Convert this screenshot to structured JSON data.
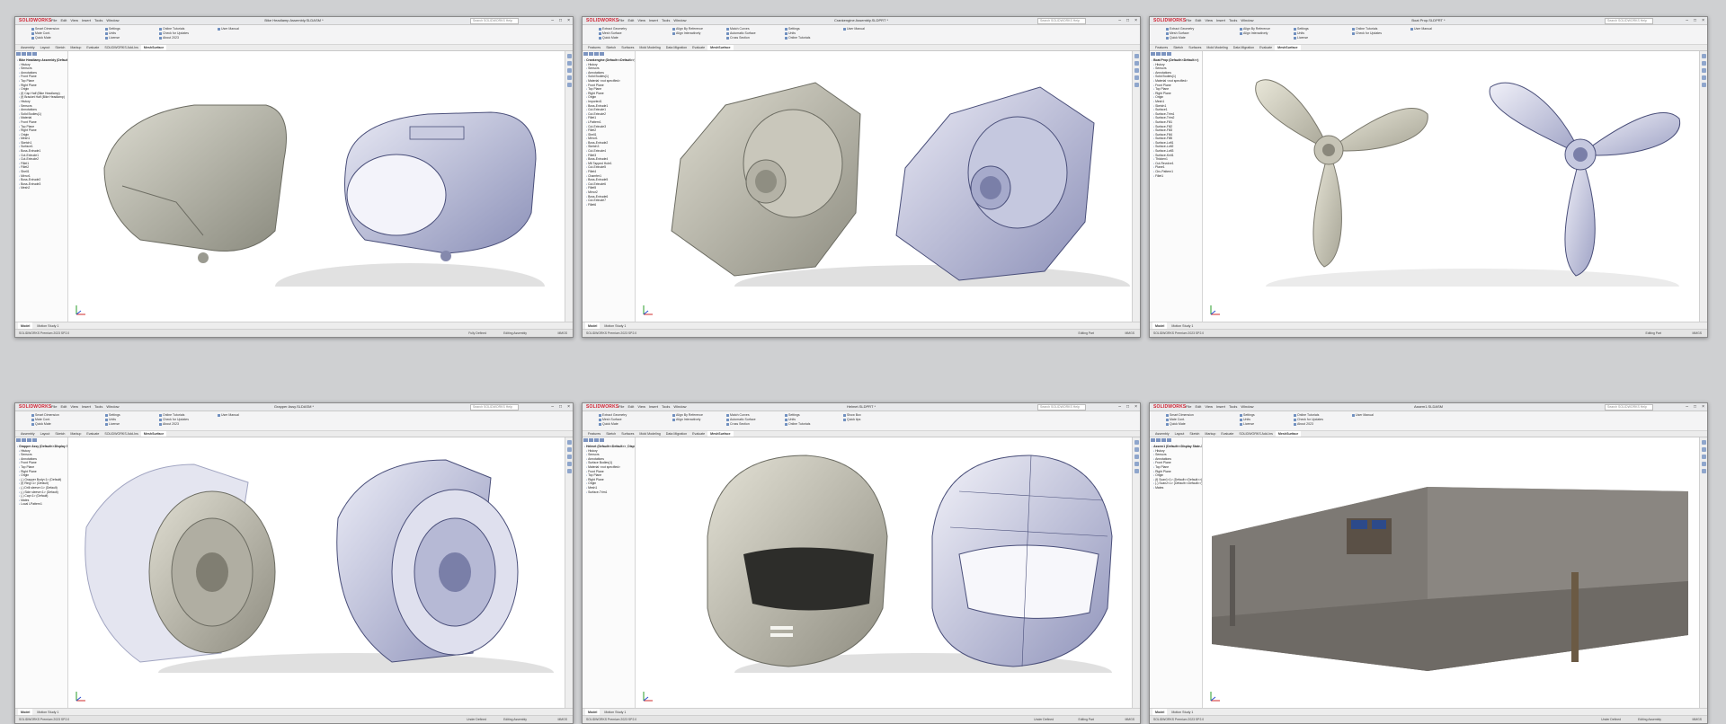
{
  "app": {
    "logo": "SOLIDWORKS",
    "menus": [
      "File",
      "Edit",
      "View",
      "Insert",
      "Tools",
      "Window"
    ],
    "search_placeholder": "Search SOLIDWORKS Help"
  },
  "windows": [
    {
      "title": "Bike Headlamp Assembly.SLDASM *",
      "model": "headlamp",
      "ribbon": [
        [
          "Smart Dimension",
          "Mate Cont.",
          "Quick Mate"
        ],
        [
          "Settings",
          "Units",
          "License"
        ],
        [
          "Online Tutorials",
          "Check for Updates",
          "About 2023"
        ],
        [
          "User Manual"
        ]
      ],
      "tabs": [
        "Assembly",
        "Layout",
        "Sketch",
        "Markup",
        "Evaluate",
        "SOLIDWORKS Add-Ins",
        "MeshSurface"
      ],
      "active_tab": "MeshSurface",
      "tree": [
        "Bike Headlamp Assembly (Default)",
        "History",
        "Sensors",
        "Annotations",
        "Front Plane",
        "Top Plane",
        "Right Plane",
        "Origin",
        "(f) Cap Half (Bike Headlamp)",
        "(f) Bracket Half (Bike Headlamp)",
        "History",
        "Sensors",
        "Annotations",
        "Solid Bodies(1)",
        "Material",
        "Front Plane",
        "Top Plane",
        "Right Plane",
        "Origin",
        "Mesh1",
        "Sketch1",
        "Surface1",
        "Boss-Extrude1",
        "Cut-Extrude1",
        "Cut-Extrude2",
        "Fillet1",
        "Fillet2",
        "Shell1",
        "Mirror1",
        "Boss-Extrude2",
        "Boss-Extrude3",
        "Mesh2"
      ],
      "bottom_tabs": [
        "Model",
        "Motion Study 1"
      ],
      "status_left": "SOLIDWORKS Premium 2023 SP2.0",
      "status_right": [
        "Fully Defined",
        "Editing Assembly",
        "MMGS"
      ]
    },
    {
      "title": "Crankengine Assembly.SLDPRT *",
      "model": "gearbox",
      "ribbon": [
        [
          "Extract Geometry",
          "Mesh Surface",
          "Quick Mate"
        ],
        [
          "Align By Reference",
          "Align Interactively"
        ],
        [
          "Match Curves",
          "Automatic Surface",
          "Cross Section"
        ],
        [
          "Settings",
          "Units",
          "Online Tutorials"
        ],
        [
          "User Manual"
        ]
      ],
      "tabs": [
        "Features",
        "Sketch",
        "Surfaces",
        "Mold Modeling",
        "Data Migration",
        "Evaluate",
        "MeshSurface"
      ],
      "active_tab": "MeshSurface",
      "tree": [
        "Crankengine (Default<<Default>>)",
        "History",
        "Sensors",
        "Annotations",
        "Solid Bodies(1)",
        "Material <not specified>",
        "Front Plane",
        "Top Plane",
        "Right Plane",
        "Origin",
        "Imported1",
        "Boss-Extrude1",
        "Cut-Extrude1",
        "Cut-Extrude2",
        "Fillet1",
        "LPattern1",
        "Cut-Extrude3",
        "Fillet2",
        "Shell1",
        "Mirror1",
        "Boss-Extrude2",
        "Sketch3",
        "Cut-Extrude4",
        "Fillet3",
        "Boss-Extrude4",
        "M6 Tapped Hole1",
        "Cut-Extrude5",
        "Fillet4",
        "Chamfer1",
        "Boss-Extrude5",
        "Cut-Extrude6",
        "Fillet5",
        "Mirror2",
        "Boss-Extrude6",
        "Cut-Extrude7",
        "Fillet6"
      ],
      "bottom_tabs": [
        "Model",
        "Motion Study 1"
      ],
      "status_left": "SOLIDWORKS Premium 2023 SP2.0",
      "status_right": [
        "Editing Part",
        "MMGS"
      ]
    },
    {
      "title": "Boat Prop.SLDPRT *",
      "model": "propeller",
      "ribbon": [
        [
          "Extract Geometry",
          "Mesh Surface",
          "Quick Mate"
        ],
        [
          "Align By Reference",
          "Align Interactively"
        ],
        [
          "Settings",
          "Units",
          "License"
        ],
        [
          "Online Tutorials",
          "Check for Updates"
        ],
        [
          "User Manual"
        ]
      ],
      "tabs": [
        "Features",
        "Sketch",
        "Surfaces",
        "Mold Modeling",
        "Data Migration",
        "Evaluate",
        "MeshSurface"
      ],
      "active_tab": "MeshSurface",
      "tree": [
        "Boat Prop (Default<<Default>>)",
        "History",
        "Sensors",
        "Annotations",
        "Solid Bodies(1)",
        "Material <not specified>",
        "Front Plane",
        "Top Plane",
        "Right Plane",
        "Origin",
        "Mesh1",
        "Sketch1",
        "Surface1",
        "Surface-Trim1",
        "Surface-Trim2",
        "Surface-Fill1",
        "Surface-Fill2",
        "Surface-Fill3",
        "Surface-Fill4",
        "Surface-Fill5",
        "Surface-Loft1",
        "Surface-Loft2",
        "Surface-Loft3",
        "Surface-Knit1",
        "Thicken1",
        "Cut-Revolve1",
        "Plane1",
        "Circ-Pattern1",
        "Fillet1"
      ],
      "bottom_tabs": [
        "Model",
        "Motion Study 1"
      ],
      "status_left": "SOLIDWORKS Premium 2023 SP2.0",
      "status_right": [
        "Editing Part",
        "MMGS"
      ]
    },
    {
      "title": "Grapper Assy.SLDASM *",
      "model": "rotary",
      "ribbon": [
        [
          "Smart Dimension",
          "Mate Cont.",
          "Quick Mate"
        ],
        [
          "Settings",
          "Units",
          "License"
        ],
        [
          "Online Tutorials",
          "Check for Updates",
          "About 2023"
        ],
        [
          "User Manual"
        ]
      ],
      "tabs": [
        "Assembly",
        "Layout",
        "Sketch",
        "Markup",
        "Evaluate",
        "SOLIDWORKS Add-Ins",
        "MeshSurface"
      ],
      "active_tab": "MeshSurface",
      "tree": [
        "Grapper Assy (Default<<Display State-1>>)",
        "History",
        "Sensors",
        "Annotations",
        "Front Plane",
        "Top Plane",
        "Right Plane",
        "Origin",
        "(-) Grapper Body<1> (Default)",
        "(f) Ring<1> (Default)",
        "(-) Drill sleeve<1> (Default)",
        "(-) Side sleeve<1> (Default)",
        "(-) Cap<1> (Default)",
        "Mates",
        "Local LPattern1"
      ],
      "bottom_tabs": [
        "Model",
        "Motion Study 1"
      ],
      "status_left": "SOLIDWORKS Premium 2023 SP2.0",
      "status_right": [
        "Under Defined",
        "Editing Assembly",
        "MMGS"
      ]
    },
    {
      "title": "Helmet.SLDPRT *",
      "model": "helmet",
      "ribbon": [
        [
          "Extract Geometry",
          "Mesh Surface",
          "Quick Mate"
        ],
        [
          "Align By Reference",
          "Align Interactively"
        ],
        [
          "Match Curves",
          "Automatic Surface",
          "Cross Section"
        ],
        [
          "Settings",
          "Units",
          "Online Tutorials"
        ],
        [
          "Show Box",
          "Quick tips"
        ]
      ],
      "tabs": [
        "Features",
        "Sketch",
        "Surfaces",
        "Mold Modeling",
        "Data Migration",
        "Evaluate",
        "MeshSurface"
      ],
      "active_tab": "MeshSurface",
      "tree": [
        "Helmet (Default<<Default>>_Display",
        "History",
        "Sensors",
        "Annotations",
        "Surface Bodies(1)",
        "Material <not specified>",
        "Front Plane",
        "Top Plane",
        "Right Plane",
        "Origin",
        "Mesh1",
        "Surface-Trim1"
      ],
      "bottom_tabs": [
        "Model",
        "Motion Study 1"
      ],
      "status_left": "SOLIDWORKS Premium 2023 SP2.0",
      "status_right": [
        "Under Defined",
        "Editing Part",
        "MMGS"
      ]
    },
    {
      "title": "Assem1.SLDASM",
      "model": "room",
      "ribbon": [
        [
          "Smart Dimension",
          "Mate Cont.",
          "Quick Mate"
        ],
        [
          "Settings",
          "Units",
          "License"
        ],
        [
          "Online Tutorials",
          "Check for Updates",
          "About 2023"
        ],
        [
          "User Manual"
        ]
      ],
      "tabs": [
        "Assembly",
        "Layout",
        "Sketch",
        "Markup",
        "Evaluate",
        "SOLIDWORKS Add-Ins",
        "MeshSurface"
      ],
      "active_tab": "MeshSurface",
      "tree": [
        "Assem1 (Default<<Display State-1>>)",
        "History",
        "Sensors",
        "Annotations",
        "Front Plane",
        "Top Plane",
        "Right Plane",
        "Origin",
        "(f) Scan1<1> (Default<<Default>>)",
        "(-) Scan2<1> (Default<<Default>>)",
        "Mates"
      ],
      "bottom_tabs": [
        "Model",
        "Motion Study 1"
      ],
      "status_left": "SOLIDWORKS Premium 2023 SP2.0",
      "status_right": [
        "Under Defined",
        "Editing Assembly",
        "MMGS"
      ]
    }
  ]
}
